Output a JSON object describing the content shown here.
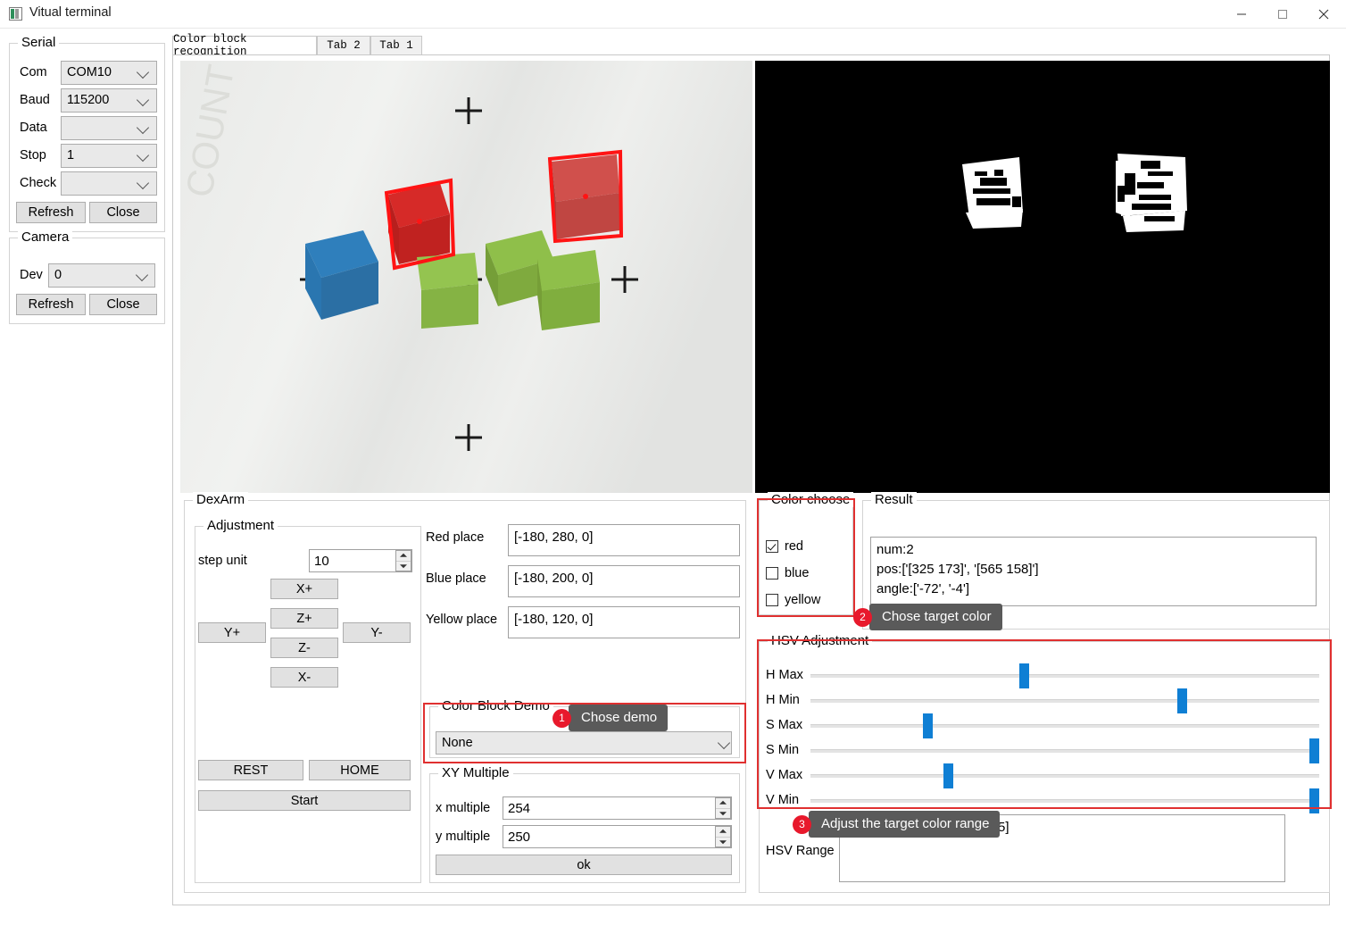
{
  "window": {
    "title": "Vitual terminal",
    "icon": "app-icon",
    "minimize": "minimize-icon",
    "maximize": "maximize-icon",
    "close": "close-icon"
  },
  "sidebar": {
    "serial": {
      "legend": "Serial",
      "fields": [
        {
          "label": "Com",
          "value": "COM10"
        },
        {
          "label": "Baud",
          "value": "115200"
        },
        {
          "label": "Data",
          "value": ""
        },
        {
          "label": "Stop",
          "value": "1"
        },
        {
          "label": "Check",
          "value": ""
        }
      ],
      "refresh_label": "Refresh",
      "close_label": "Close"
    },
    "camera": {
      "legend": "Camera",
      "dev_label": "Dev",
      "dev_value": "0",
      "refresh_label": "Refresh",
      "close_label": "Close"
    }
  },
  "tabs": [
    {
      "label": "Color block recognition",
      "active": true
    },
    {
      "label": "Tab 2",
      "active": false
    },
    {
      "label": "Tab 1",
      "active": false
    }
  ],
  "dexarm": {
    "legend": "DexArm",
    "adjustment": {
      "legend": "Adjustment",
      "step_unit_label": "step unit",
      "step_unit_value": "10",
      "jog": {
        "xplus": "X+",
        "xminus": "X-",
        "yplus": "Y+",
        "yminus": "Y-",
        "zplus": "Z+",
        "zminus": "Z-"
      },
      "rest_label": "REST",
      "home_label": "HOME",
      "start_label": "Start"
    },
    "places": [
      {
        "label": "Red place",
        "value": "[-180, 280, 0]"
      },
      {
        "label": "Blue place",
        "value": "[-180, 200, 0]"
      },
      {
        "label": "Yellow place",
        "value": "[-180, 120, 0]"
      }
    ],
    "color_block_demo": {
      "legend": "Color Block Demo",
      "selected": "None"
    },
    "xy_multiple": {
      "legend": "XY Multiple",
      "x_label": "x multiple",
      "x_value": "254",
      "y_label": "y multiple",
      "y_value": "250",
      "ok_label": "ok"
    }
  },
  "color_choose": {
    "legend": "Color choose",
    "options": [
      {
        "label": "red",
        "checked": true
      },
      {
        "label": "blue",
        "checked": false
      },
      {
        "label": "yellow",
        "checked": false
      }
    ]
  },
  "result": {
    "legend": "Result",
    "text": "num:2\npos:['[325 173]', '[565 158]']\nangle:['-72', '-4']"
  },
  "hsv": {
    "legend": "HSV Adjustment",
    "sliders": [
      {
        "label": "H Max",
        "percent": 42
      },
      {
        "label": "H Min",
        "percent": 73
      },
      {
        "label": "S Max",
        "percent": 23
      },
      {
        "label": "S Min",
        "percent": 99
      },
      {
        "label": "V Max",
        "percent": 27
      },
      {
        "label": "V Min",
        "percent": 99
      }
    ],
    "range_label": "HSV Range",
    "range_value": "[168, 190, 35, 255, 70, 255]"
  },
  "callouts": [
    {
      "number": "1",
      "text": "Chose demo"
    },
    {
      "number": "2",
      "text": "Chose target color"
    },
    {
      "number": "3",
      "text": "Adjust the target color range"
    }
  ],
  "colors": {
    "accent_red": "#e03030",
    "badge_red": "#e8192c",
    "slider_blue": "#0f7fd4",
    "bubble_gray": "#5a5a5a"
  },
  "camera_view": {
    "name": "camera-preview",
    "crosshairs": 4,
    "blocks": [
      {
        "color": "red",
        "detected": true
      },
      {
        "color": "red",
        "detected": true
      },
      {
        "color": "blue",
        "detected": false
      },
      {
        "color": "green",
        "detected": false
      },
      {
        "color": "green",
        "detected": false
      },
      {
        "color": "green",
        "detected": false
      }
    ]
  },
  "mask_view": {
    "name": "binary-mask-preview",
    "blobs": 2
  }
}
